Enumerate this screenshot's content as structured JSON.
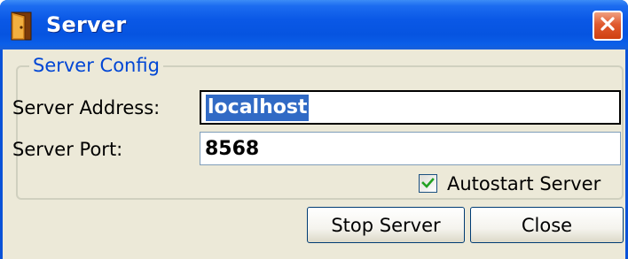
{
  "window": {
    "title": "Server",
    "close_icon": "close-x-icon"
  },
  "group": {
    "legend": "Server Config",
    "address_label": "Server Address:",
    "address_value": "localhost",
    "port_label": "Server Port:",
    "port_value": "8568",
    "autostart_label": "Autostart Server",
    "autostart_checked": true
  },
  "buttons": {
    "stop_label": "Stop Server",
    "close_label": "Close"
  },
  "colors": {
    "titlebar": "#0a58e6",
    "legend": "#0046d5",
    "selection": "#316ac5",
    "close_button": "#e05a30",
    "checkmark": "#21a121"
  }
}
